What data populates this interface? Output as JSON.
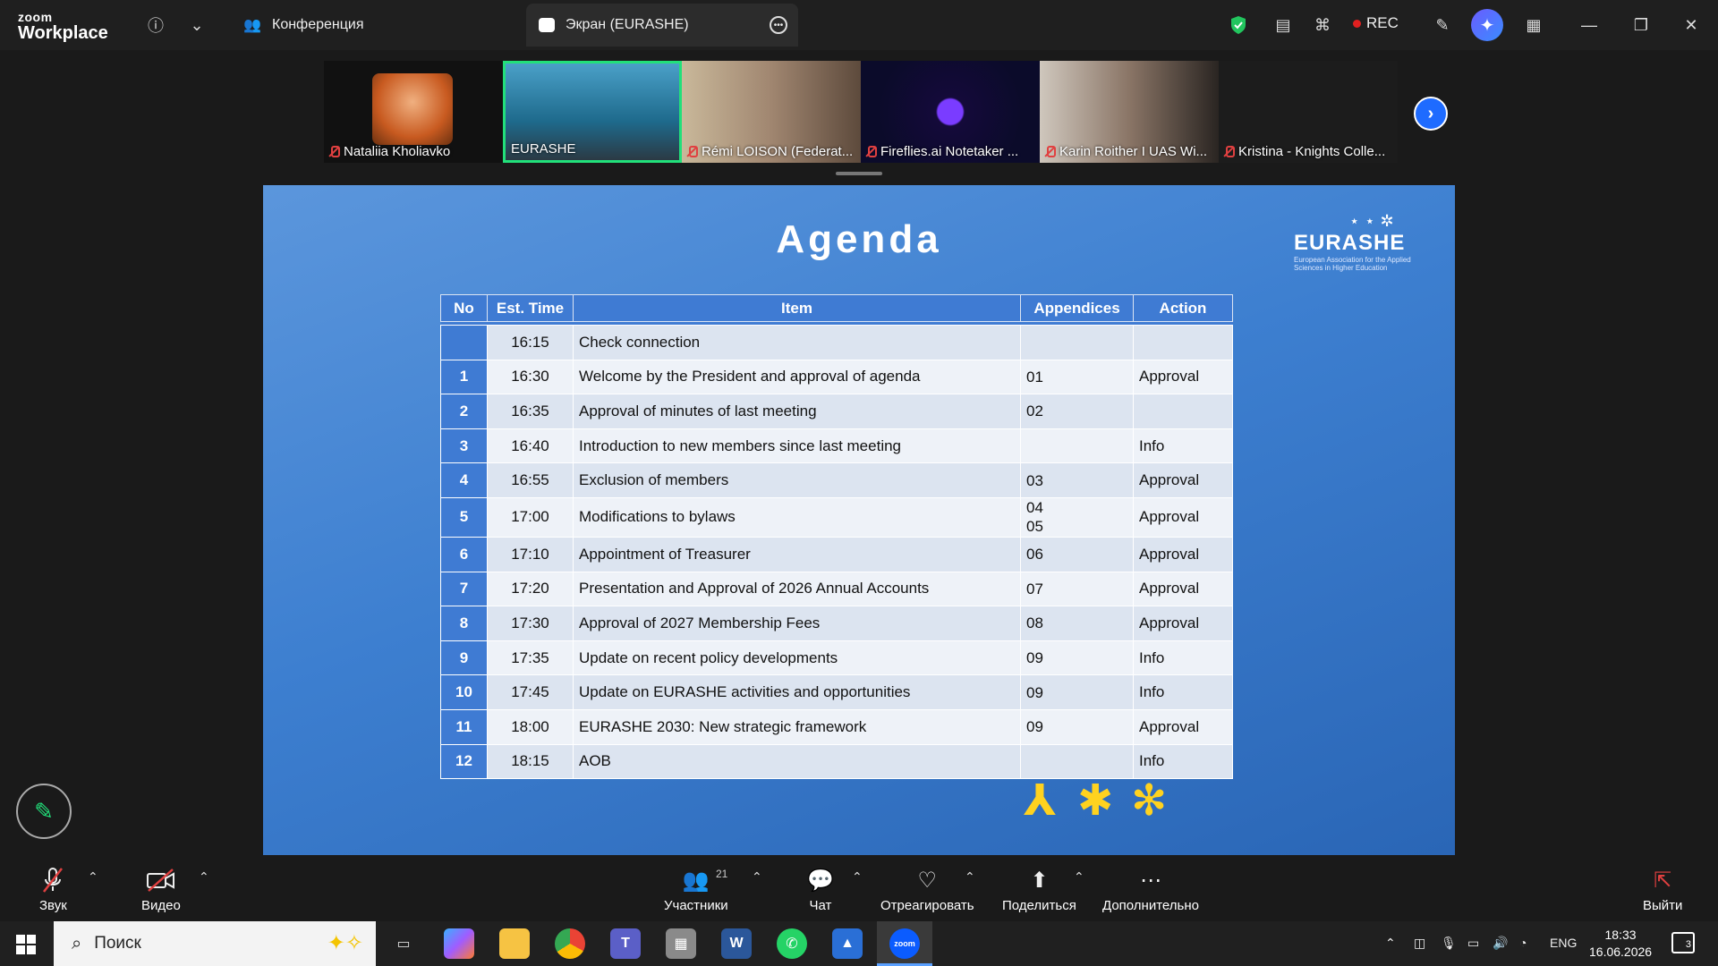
{
  "topbar": {
    "logo_small": "zoom",
    "logo_big": "Workplace",
    "tab_conference": "Конференция",
    "tab_screen": "Экран (EURASHE)",
    "rec_label": "REC"
  },
  "participants": [
    {
      "name": "Nataliia Kholiavko"
    },
    {
      "name": "EURASHE"
    },
    {
      "name": "Rémi LOISON (Federat..."
    },
    {
      "name": "Fireflies.ai Notetaker ..."
    },
    {
      "name": "Karin Roither I UAS Wi..."
    },
    {
      "name": "Kristina - Knights Colle..."
    }
  ],
  "slide": {
    "title": "Agenda",
    "logo_word": "EURASHE",
    "logo_sub": "European Association for the Applied Sciences in Higher Education",
    "headers": [
      "No",
      "Est. Time",
      "Item",
      "Appendices",
      "Action"
    ],
    "rows": [
      {
        "no": "",
        "time": "16:15",
        "item": "Check connection",
        "app": "",
        "action": ""
      },
      {
        "no": "1",
        "time": "16:30",
        "item": "Welcome by the President and approval of agenda",
        "app": "01",
        "action": "Approval"
      },
      {
        "no": "2",
        "time": "16:35",
        "item": "Approval of minutes of last meeting",
        "app": "02",
        "action": ""
      },
      {
        "no": "3",
        "time": "16:40",
        "item": "Introduction to new members since last meeting",
        "app": "",
        "action": "Info"
      },
      {
        "no": "4",
        "time": "16:55",
        "item": "Exclusion of members",
        "app": "03",
        "action": "Approval"
      },
      {
        "no": "5",
        "time": "17:00",
        "item": "Modifications to bylaws",
        "app": "04\n05",
        "action": "Approval"
      },
      {
        "no": "6",
        "time": "17:10",
        "item": "Appointment of Treasurer",
        "app": "06",
        "action": "Approval"
      },
      {
        "no": "7",
        "time": "17:20",
        "item": "Presentation and Approval of 2026 Annual Accounts",
        "app": "07",
        "action": "Approval"
      },
      {
        "no": "8",
        "time": "17:30",
        "item": "Approval of 2027 Membership Fees",
        "app": "08",
        "action": "Approval"
      },
      {
        "no": "9",
        "time": "17:35",
        "item": "Update on recent policy developments",
        "app": "09",
        "action": "Info"
      },
      {
        "no": "10",
        "time": "17:45",
        "item": "Update on EURASHE activities and opportunities",
        "app": "09",
        "action": "Info"
      },
      {
        "no": "11",
        "time": "18:00",
        "item": "EURASHE 2030: New strategic framework",
        "app": "09",
        "action": "Approval"
      },
      {
        "no": "12",
        "time": "18:15",
        "item": "AOB",
        "app": "",
        "action": "Info"
      }
    ]
  },
  "controls": {
    "audio": "Звук",
    "video": "Видео",
    "participants": "Участники",
    "participants_count": "21",
    "chat": "Чат",
    "react": "Отреагировать",
    "share": "Поделиться",
    "more": "Дополнительно",
    "leave": "Выйти"
  },
  "taskbar": {
    "search_placeholder": "Поиск",
    "lang": "ENG",
    "time": "18:33",
    "date": "16.06.2026",
    "notifications": "3"
  },
  "colors": {
    "accent_green": "#22e07a",
    "zoom_blue": "#1e6bff",
    "slide_blue": "#3f7bd3",
    "deco_yellow": "#ffd21f",
    "rec_red": "#e02020"
  }
}
